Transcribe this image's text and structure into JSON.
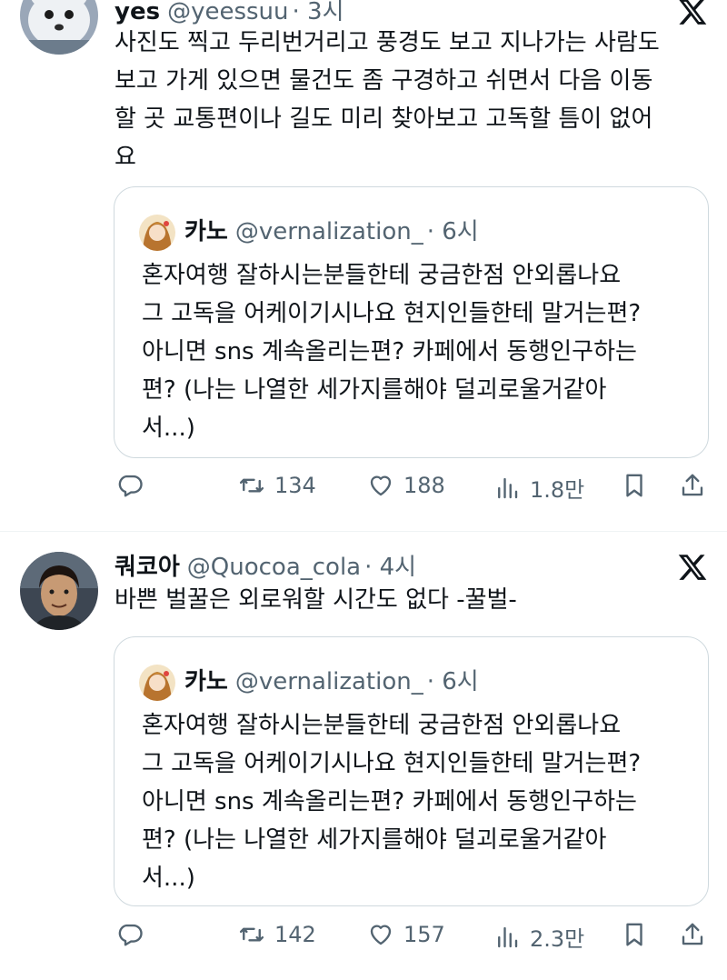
{
  "tweets": [
    {
      "name": "yes",
      "handle": "@yeessuu",
      "time": "· 3시",
      "lines": [
        "사진도 찍고 두리번거리고 풍경도 보고 지나가는 사람도",
        "보고 가게 있으면 물건도 좀 구경하고 쉬면서 다음 이동",
        "할 곳 교통편이나 길도 미리 찾아보고 고독할 틈이 없어",
        "요"
      ],
      "quote": {
        "name": "카노",
        "handle": "@vernalization_",
        "time": "· 6시",
        "lines": [
          "혼자여행 잘하시는분들한테 궁금한점 안외롭나요",
          "그 고독을 어케이기시나요 현지인들한테 말거는편?",
          "아니면 sns 계속올리는편? 카페에서 동행인구하는",
          "편? (나는 나열한 세가지를해야 덜괴로울거같아",
          "서...)"
        ]
      },
      "retweets": "134",
      "likes": "188",
      "views": "1.8만"
    },
    {
      "name": "쿼코아",
      "handle": "@Quocoa_cola",
      "time": "· 4시",
      "lines": [
        "바쁜 벌꿀은 외로워할 시간도 없다 -꿀벌-"
      ],
      "quote": {
        "name": "카노",
        "handle": "@vernalization_",
        "time": "· 6시",
        "lines": [
          "혼자여행 잘하시는분들한테 궁금한점 안외롭나요",
          "그 고독을 어케이기시나요 현지인들한테 말거는편?",
          "아니면 sns 계속올리는편? 카페에서 동행인구하는",
          "편? (나는 나열한 세가지를해야 덜괴로울거같아",
          "서...)"
        ]
      },
      "retweets": "142",
      "likes": "157",
      "views": "2.3만"
    }
  ],
  "colors": {
    "text": "#0f1419",
    "secondary": "#536471",
    "border": "#cfd9de"
  },
  "icons": [
    "x-logo-icon",
    "reply-icon",
    "retweet-icon",
    "like-icon",
    "views-icon",
    "bookmark-icon",
    "share-icon"
  ]
}
